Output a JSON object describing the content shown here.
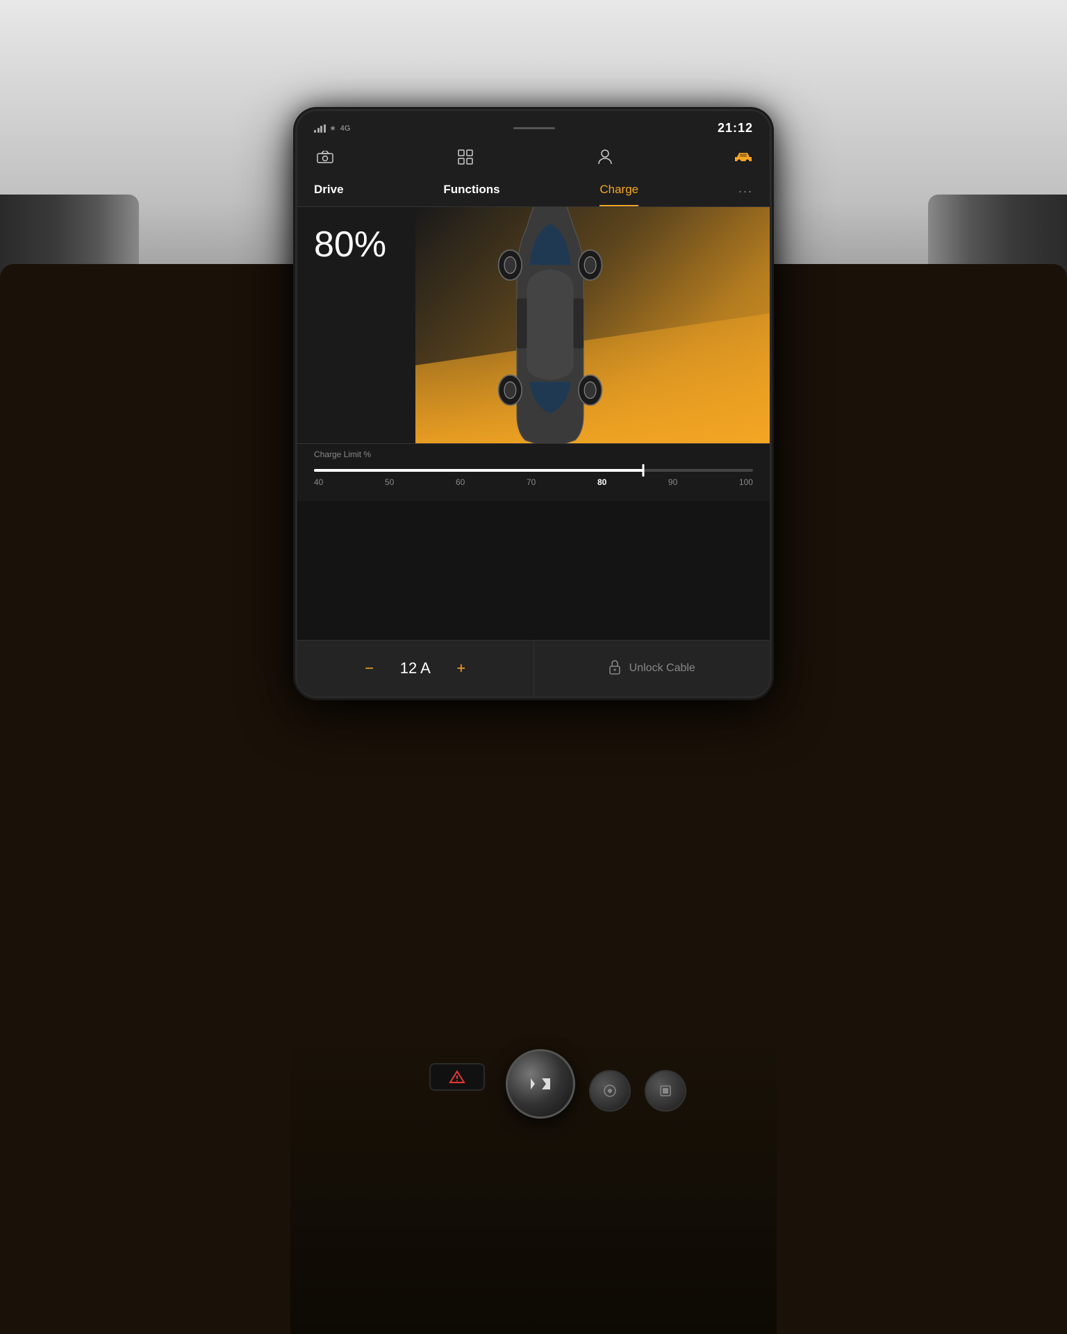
{
  "background": {
    "color": "#1a1a1a"
  },
  "screen": {
    "status_bar": {
      "signal_label": "4G",
      "time": "21:12",
      "bluetooth": "BT"
    },
    "nav": {
      "camera_icon": "camera",
      "grid_icon": "grid",
      "user_icon": "person",
      "car_icon": "car"
    },
    "tabs": [
      {
        "label": "Drive",
        "active": false
      },
      {
        "label": "Functions",
        "active": false
      },
      {
        "label": "Charge",
        "active": true
      },
      {
        "label": "...",
        "active": false
      }
    ],
    "charge_section": {
      "percentage": "80%",
      "charge_limit_label": "Charge Limit %",
      "slider_marks": [
        "40",
        "50",
        "60",
        "70",
        "80",
        "90",
        "100"
      ],
      "active_mark": "80",
      "slider_value": 75
    },
    "bottom_controls": {
      "minus_label": "−",
      "current_value": "12 A",
      "plus_label": "+",
      "lock_icon": "lock",
      "unlock_label": "Unlock Cable"
    }
  },
  "colors": {
    "accent": "#f5a623",
    "active_tab": "#f5a623",
    "text_primary": "#ffffff",
    "text_secondary": "#888888",
    "bg_screen": "#1e1e1e",
    "bg_dark": "#1a1a1a"
  }
}
